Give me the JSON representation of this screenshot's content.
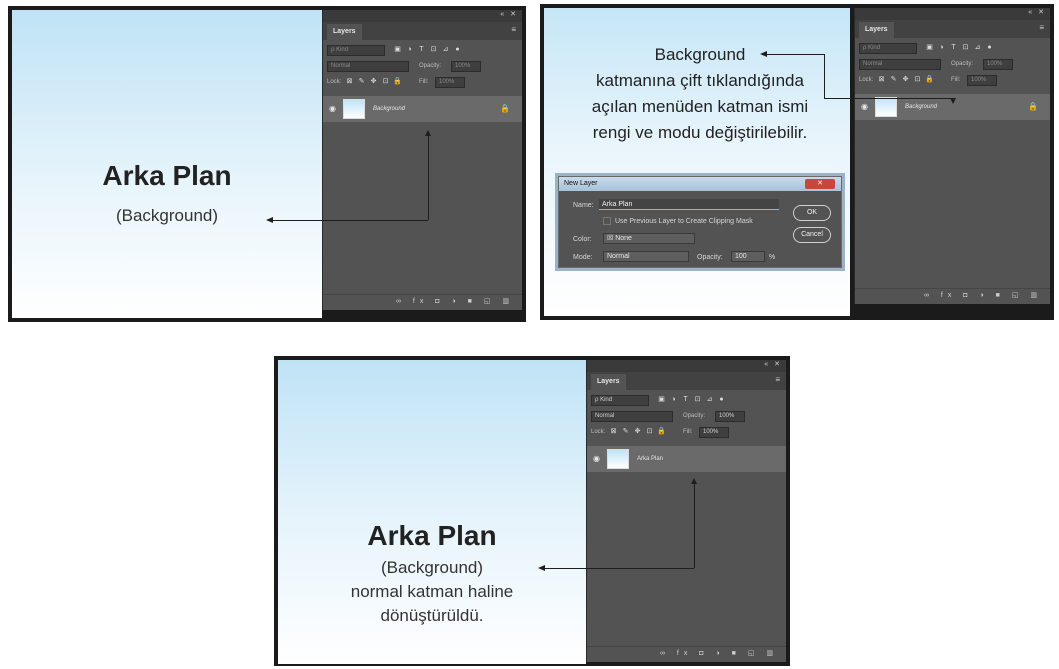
{
  "panel_common": {
    "win_btns": "«  ✕",
    "tab": "Layers",
    "menu": "≡",
    "kind": "ρ Kind",
    "filter_icons": [
      "▣",
      "◑",
      "T",
      "⊡",
      "⊿",
      "●"
    ],
    "blend": "Normal",
    "opacity_label": "Opacity:",
    "lock_label": "Lock:",
    "lock_icons": [
      "⊠",
      "✎",
      "✥",
      "⊡",
      "🔒"
    ],
    "fill_label": "Fill:",
    "footer_icons": "∞ fx ◘ ◑ ■ ◱ ▥",
    "eye": "◉",
    "lock_glyph": "🔒"
  },
  "shot1": {
    "title": "Arka Plan",
    "subtitle": "(Background)",
    "layer_name": "Background",
    "opacity": "100%",
    "fill": "100%"
  },
  "shot2": {
    "note_lines": [
      "Background",
      "katmanına çift tıklandığında",
      "açılan menüden katman ismi",
      "rengi ve modu değiştirilebilir."
    ],
    "layer_name": "Background",
    "opacity": "100%",
    "fill": "100%",
    "dialog": {
      "title": "New Layer",
      "close": "✕",
      "name_label": "Name:",
      "name_value": "Arka Plan",
      "clip_label": "Use Previous Layer to Create Clipping Mask",
      "color_label": "Color:",
      "color_value": "☒ None",
      "mode_label": "Mode:",
      "mode_value": "Normal",
      "opacity_label": "Opacity:",
      "opacity_value": "100",
      "opacity_unit": "%",
      "ok": "OK",
      "cancel": "Cancel"
    }
  },
  "shot3": {
    "title": "Arka Plan",
    "caption_lines": [
      "(Background)",
      "normal katman haline",
      "dönüştürüldü."
    ],
    "layer_name": "Arka Plan",
    "opacity": "100%",
    "fill": "100%"
  }
}
